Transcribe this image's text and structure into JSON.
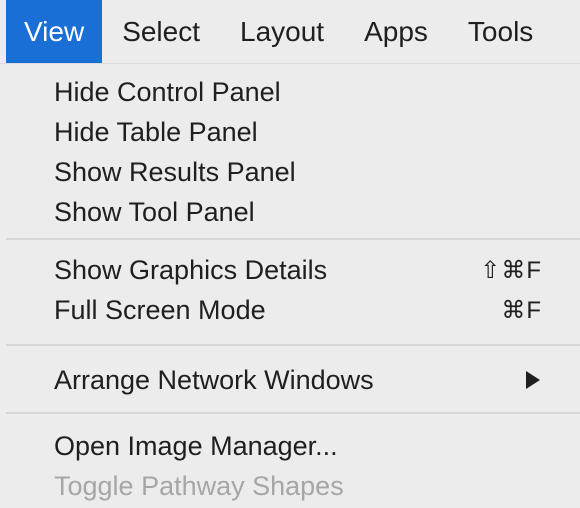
{
  "menubar": {
    "items": [
      {
        "label": "View"
      },
      {
        "label": "Select"
      },
      {
        "label": "Layout"
      },
      {
        "label": "Apps"
      },
      {
        "label": "Tools"
      }
    ],
    "active_color": "#1a6fd6"
  },
  "view_menu": {
    "group1": [
      {
        "label": "Hide Control Panel"
      },
      {
        "label": "Hide Table Panel"
      },
      {
        "label": "Show Results Panel"
      },
      {
        "label": "Show Tool Panel"
      }
    ],
    "group2": [
      {
        "label": "Show Graphics Details",
        "shortcut": "⇧⌘F"
      },
      {
        "label": "Full Screen Mode",
        "shortcut": "⌘F"
      }
    ],
    "group3": [
      {
        "label": "Arrange Network Windows",
        "icon": "submenu-arrow-icon"
      }
    ],
    "group4": [
      {
        "label": "Open Image Manager..."
      },
      {
        "label": "Toggle Pathway Shapes",
        "disabled": true
      }
    ]
  }
}
